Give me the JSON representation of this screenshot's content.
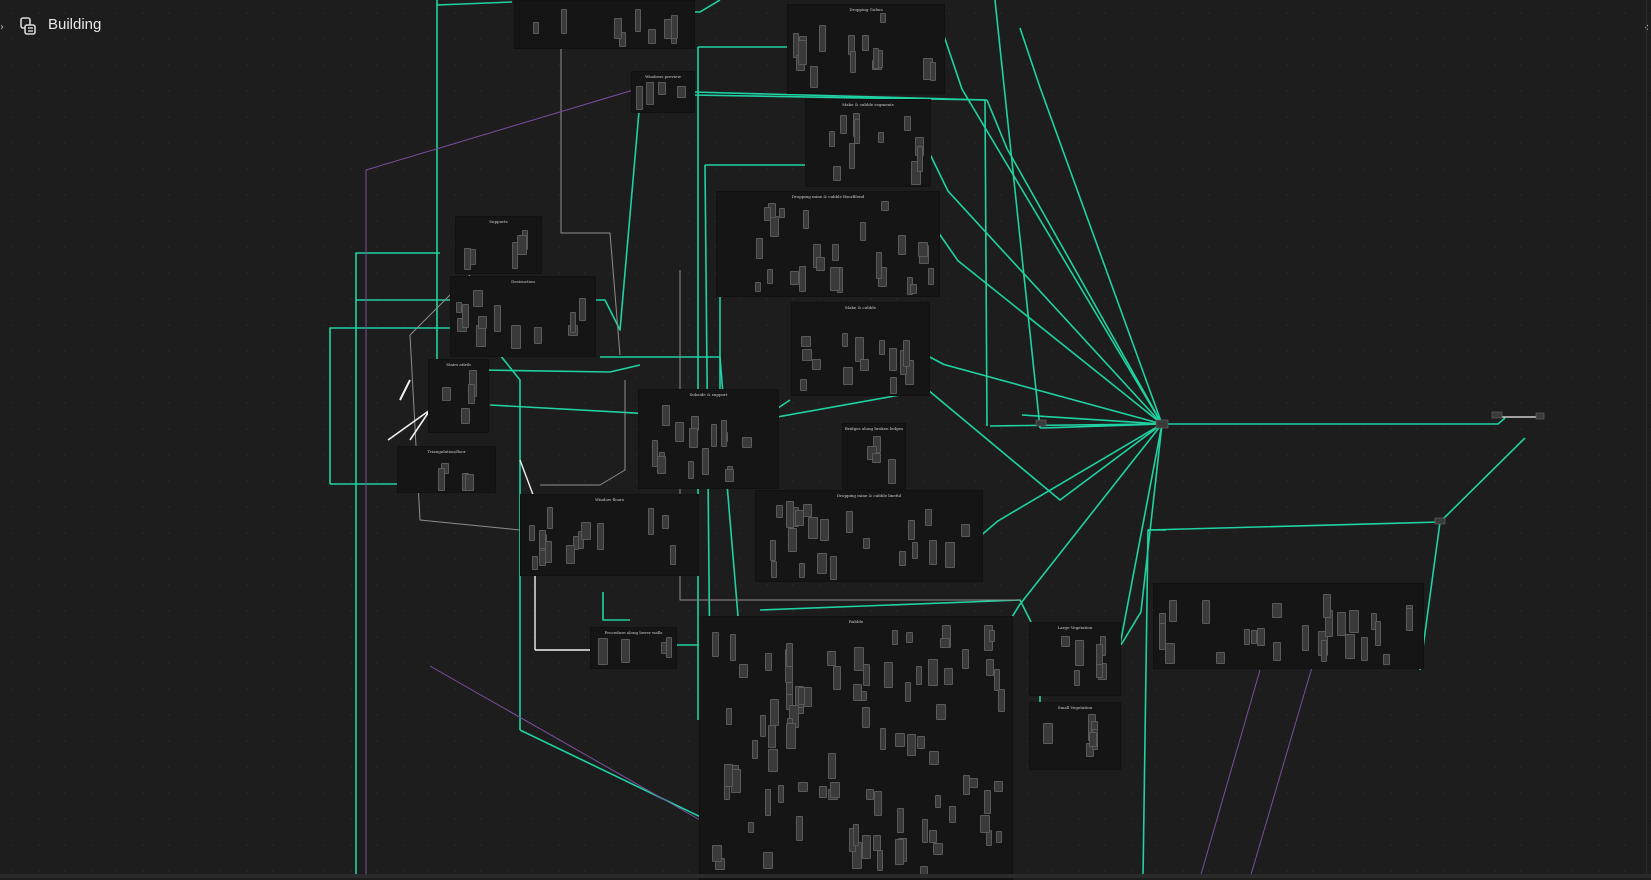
{
  "header": {
    "title": "Building",
    "icon": "node-tree-icon"
  },
  "colors": {
    "background": "#1d1d1d",
    "frame": "#151515",
    "wire_geometry": "#1fd2a2",
    "wire_float": "#8e8e8e",
    "wire_vector": "#6b5cd8",
    "wire_object": "#f0f0f0",
    "wire_purple": "#7a4f9e"
  },
  "frames": [
    {
      "title": ""
    },
    {
      "title": "Dropping Gubus"
    },
    {
      "title": "Windows preview"
    },
    {
      "title": "Make & cubble segments"
    },
    {
      "title": "Dropping mine & cubble floorBlend"
    },
    {
      "title": "Supports"
    },
    {
      "title": "Destruction"
    },
    {
      "title": "Make & cubble"
    },
    {
      "title": "Stairs attrib"
    },
    {
      "title": "Subside & support"
    },
    {
      "title": "Bridges along broken ledges"
    },
    {
      "title": "Triangulation/floor"
    },
    {
      "title": "Window floors"
    },
    {
      "title": "Dropping mine & cubble lineful"
    },
    {
      "title": "Rubble"
    },
    {
      "title": "Procedure along lower walls"
    },
    {
      "title": "Large Vegetation"
    },
    {
      "title": "Small Vegetation"
    },
    {
      "title": ""
    }
  ]
}
